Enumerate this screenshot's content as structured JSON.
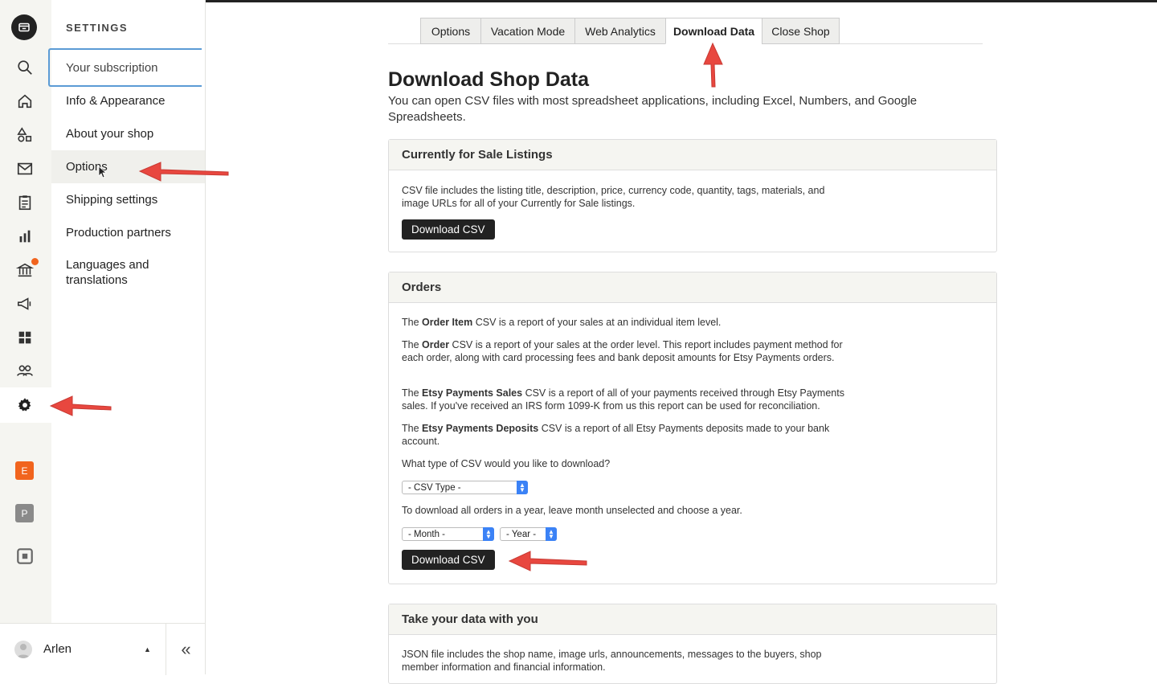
{
  "sidebar": {
    "heading": "SETTINGS",
    "items": [
      {
        "label": "Your subscription"
      },
      {
        "label": "Info & Appearance"
      },
      {
        "label": "About your shop"
      },
      {
        "label": "Options"
      },
      {
        "label": "Shipping settings"
      },
      {
        "label": "Production partners"
      },
      {
        "label": "Languages and translations"
      }
    ],
    "shop_badges": [
      {
        "letter": "E",
        "color": "#f1641e"
      },
      {
        "letter": "P",
        "color": "#8a8a8a"
      }
    ]
  },
  "user": {
    "name": "Arlen"
  },
  "tabs": [
    {
      "label": "Options"
    },
    {
      "label": "Vacation Mode"
    },
    {
      "label": "Web Analytics"
    },
    {
      "label": "Download Data"
    },
    {
      "label": "Close Shop"
    }
  ],
  "page": {
    "title": "Download Shop Data",
    "intro": "You can open CSV files with most spreadsheet applications, including Excel, Numbers, and Google Spreadsheets."
  },
  "listings_panel": {
    "title": "Currently for Sale Listings",
    "description": "CSV file includes the listing title, description, price, currency code, quantity, tags, materials, and image URLs for all of your Currently for Sale listings.",
    "button": "Download CSV"
  },
  "orders_panel": {
    "title": "Orders",
    "p1": {
      "pre": "The ",
      "bold": "Order Item",
      "post": " CSV is a report of your sales at an individual item level."
    },
    "p2": {
      "pre": "The ",
      "bold": "Order",
      "post": " CSV is a report of your sales at the order level. This report includes payment method for each order, along with card processing fees and bank deposit amounts for Etsy Payments orders."
    },
    "p3": {
      "pre": "The ",
      "bold": "Etsy Payments Sales",
      "post": " CSV is a report of all of your payments received through Etsy Payments sales. If you've received an IRS form 1099-K from us this report can be used for reconciliation."
    },
    "p4": {
      "pre": "The ",
      "bold": "Etsy Payments Deposits",
      "post": " CSV is a report of all Etsy Payments deposits made to your bank account."
    },
    "csv_question": "What type of CSV would you like to download?",
    "csv_type": "- CSV Type -",
    "year_hint": "To download all orders in a year, leave month unselected and choose a year.",
    "month": "- Month -",
    "year": "- Year -",
    "button": "Download CSV"
  },
  "data_panel": {
    "title": "Take your data with you",
    "description": "JSON file includes the shop name, image urls, announcements, messages to the buyers, shop member information and financial information."
  },
  "colors": {
    "accent": "#f1641e",
    "annotation_arrow": "#e8473f",
    "dark_button": "#222222",
    "focus_outline": "#5b9bd5"
  }
}
